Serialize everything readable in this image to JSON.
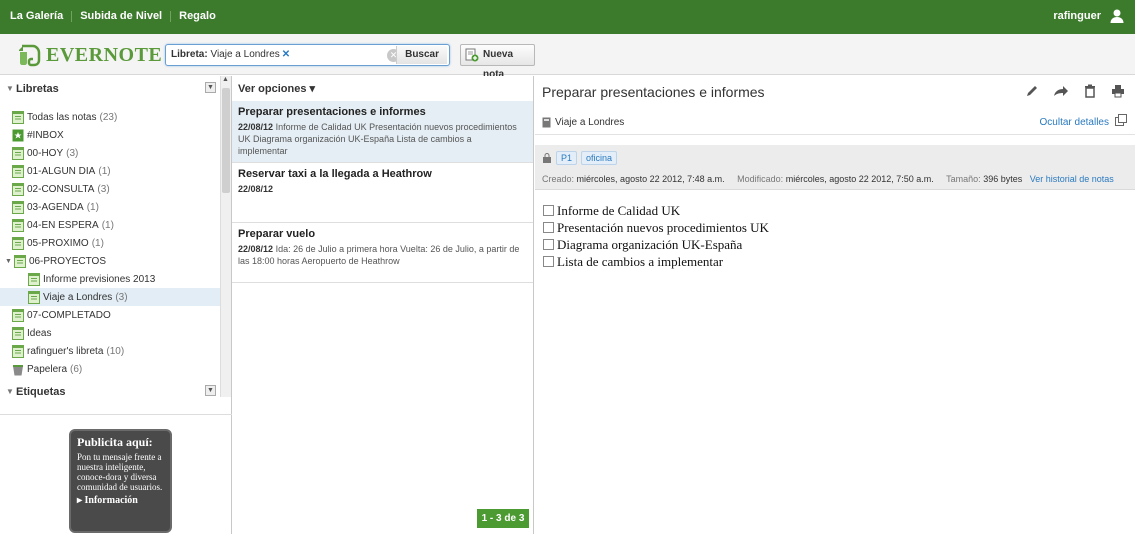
{
  "topbar": {
    "links": [
      "La Galería",
      "Subida de Nivel",
      "Regalo"
    ],
    "username": "rafinguer"
  },
  "header": {
    "logo": "EVERNOTE",
    "search_prefix": "Libreta:",
    "search_value": "Viaje a Londres",
    "search_button": "Buscar",
    "new_note_label": "Nueva nota"
  },
  "sidebar": {
    "notebooks_heading": "Libretas",
    "notebooks": [
      {
        "label": "Todas las notas",
        "count": "(23)"
      },
      {
        "label": "#INBOX",
        "count": ""
      },
      {
        "label": "00-HOY",
        "count": "(3)"
      },
      {
        "label": "01-ALGUN DIA",
        "count": "(1)"
      },
      {
        "label": "02-CONSULTA",
        "count": "(3)"
      },
      {
        "label": "03-AGENDA",
        "count": "(1)"
      },
      {
        "label": "04-EN ESPERA",
        "count": "(1)"
      },
      {
        "label": "05-PROXIMO",
        "count": "(1)"
      },
      {
        "label": "06-PROYECTOS",
        "count": ""
      },
      {
        "label": "Informe previsiones 2013",
        "count": ""
      },
      {
        "label": "Viaje a Londres",
        "count": "(3)"
      },
      {
        "label": "07-COMPLETADO",
        "count": ""
      },
      {
        "label": "Ideas",
        "count": ""
      },
      {
        "label": "rafinguer's libreta",
        "count": "(10)"
      },
      {
        "label": "Papelera",
        "count": "(6)"
      }
    ],
    "tags_heading": "Etiquetas"
  },
  "ad": {
    "title": "Publicita aquí:",
    "body": "Pon tu mensaje frente a nuestra inteligente, conoce-dora y diversa comunidad de usuarios.",
    "link": "▸ Información"
  },
  "notelist": {
    "options": "Ver opciones ▾",
    "notes": [
      {
        "title": "Preparar presentaciones e informes",
        "date": "22/08/12",
        "snippet": "Informe de Calidad UK Presentación nuevos procedimientos UK Diagrama organización UK-España Lista de cambios a implementar"
      },
      {
        "title": "Reservar taxi a la llegada a Heathrow",
        "date": "22/08/12",
        "snippet": ""
      },
      {
        "title": "Preparar vuelo",
        "date": "22/08/12",
        "snippet": "Ida: 26 de Julio a primera hora Vuelta: 26 de Julio, a partir de las 18:00 horas Aeropuerto de Heathrow"
      }
    ],
    "pager": "1 - 3 de 3"
  },
  "note": {
    "title": "Preparar presentaciones e informes",
    "notebook": "Viaje a Londres",
    "hide_details": "Ocultar detalles",
    "tags": [
      "P1",
      "oficina"
    ],
    "created_label": "Creado:",
    "created": "miércoles, agosto 22 2012, 7:48 a.m.",
    "modified_label": "Modificado:",
    "modified": "miércoles, agosto 22 2012, 7:50 a.m.",
    "size_label": "Tamaño:",
    "size": "396 bytes",
    "history_link": "Ver historial de notas",
    "checklist": [
      "Informe de Calidad UK",
      "Presentación nuevos procedimientos UK",
      "Diagrama organización UK-España",
      "Lista de cambios a implementar"
    ]
  },
  "colors": {
    "topbar": "#3c7a2c",
    "accent_green": "#4c9a32",
    "link_blue": "#2a7ac0",
    "selection": "#e2edf5"
  }
}
